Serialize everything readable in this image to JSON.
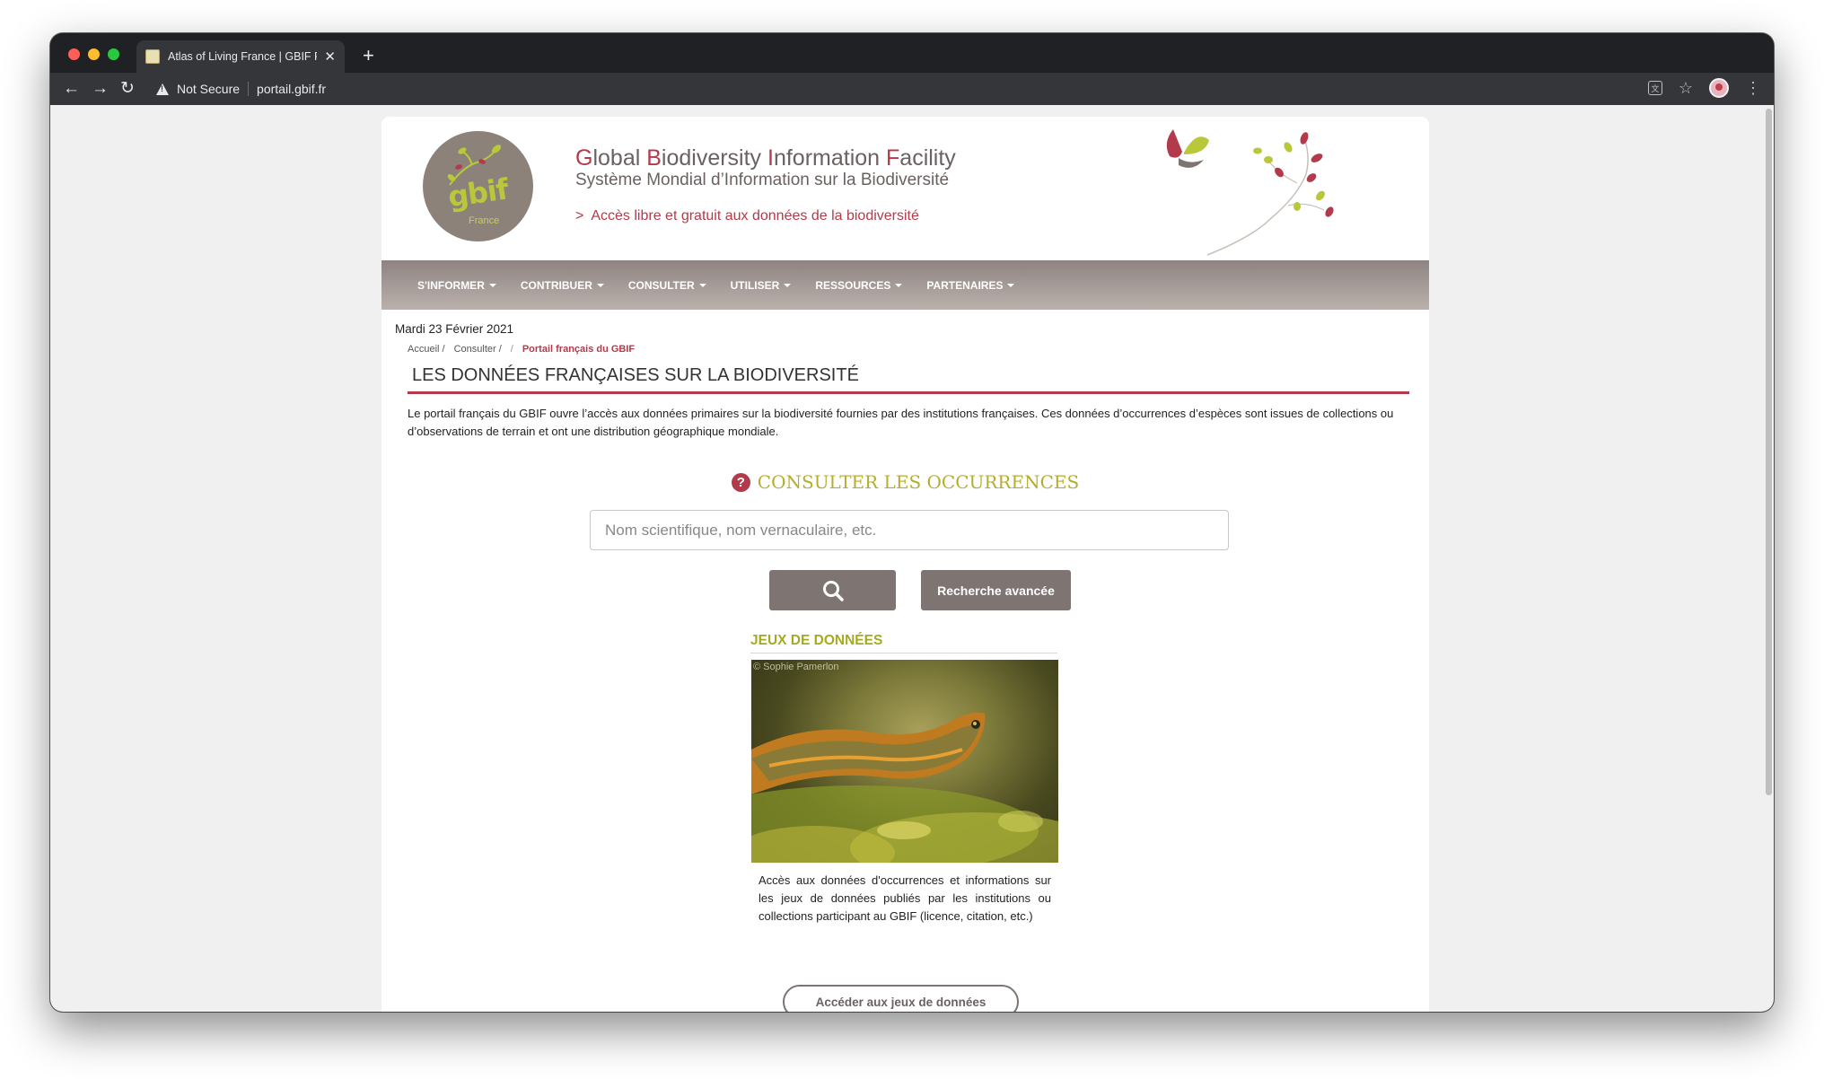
{
  "browser": {
    "tab_title": "Atlas of Living France | GBIF France",
    "new_tab": "+",
    "not_secure": "Not Secure",
    "url": "portail.gbif.fr"
  },
  "header": {
    "logo_text": "gbif",
    "logo_sub": "France",
    "title": {
      "part1_hl": "G",
      "part1": "lobal ",
      "part2_hl": "B",
      "part2": "iodiversity ",
      "part3_hl": "I",
      "part3": "nformation ",
      "part4_hl": "F",
      "part4": "acility"
    },
    "subtitle": "Système Mondial d’Information sur la Biodiversité",
    "tagline_arrow": ">",
    "tagline": "Accès libre et gratuit aux données de la biodiversité"
  },
  "nav": {
    "items": [
      "S'INFORMER",
      "CONTRIBUER",
      "CONSULTER",
      "UTILISER",
      "RESSOURCES",
      "PARTENAIRES"
    ]
  },
  "date": "Mardi 23 Février 2021",
  "breadcrumb": {
    "items": [
      "Accueil /",
      "Consulter /"
    ],
    "separator": "/",
    "current": "Portail français du GBIF"
  },
  "page_heading": "LES DONNÉES FRANÇAISES SUR LA BIODIVERSITÉ",
  "intro": "Le portail français du GBIF ouvre l’accès aux données primaires sur la biodiversité fournies par des institutions françaises. Ces données d’occurrences d’espèces sont issues de collections ou d’observations de terrain et ont une distribution géographique mondiale.",
  "occurrences": {
    "help": "?",
    "title": "CONSULTER LES OCCURRENCES",
    "search_placeholder": "Nom scientifique, nom vernaculaire, etc.",
    "advanced_label": "Recherche avancée"
  },
  "datasets": {
    "title": "JEUX DE DONNÉES",
    "photo_credit": "© Sophie Pamerlon",
    "description": "Accès aux données d'occurrences et informations sur les jeux de données publiés par les institutions ou collections participant au GBIF (licence, citation, etc.)",
    "button": "Accéder aux jeux de données"
  },
  "colors": {
    "brand_red": "#b33a4a",
    "brand_olive": "#a4ab1f",
    "nav_grey": "#8e8380"
  }
}
